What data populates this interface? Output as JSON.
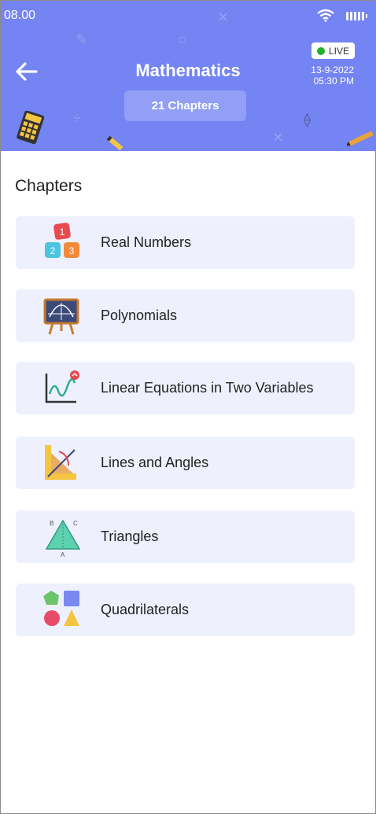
{
  "status_bar": {
    "time": "08.00"
  },
  "header": {
    "title": "Mathematics",
    "chapter_count": "21 Chapters",
    "live_label": "LIVE",
    "date": "13-9-2022",
    "time": "05:30 PM"
  },
  "section_title": "Chapters",
  "chapters": [
    {
      "label": "Real Numbers",
      "icon": "number-blocks-icon"
    },
    {
      "label": "Polynomials",
      "icon": "graph-board-icon"
    },
    {
      "label": "Linear Equations in Two Variables",
      "icon": "line-graph-icon"
    },
    {
      "label": "Lines and Angles",
      "icon": "ruler-angle-icon"
    },
    {
      "label": "Triangles",
      "icon": "triangle-icon"
    },
    {
      "label": "Quadrilaterals",
      "icon": "shapes-icon"
    }
  ],
  "colors": {
    "header_bg": "#7484f2",
    "card_bg": "#eef1fd",
    "live_dot": "#1db32a"
  }
}
